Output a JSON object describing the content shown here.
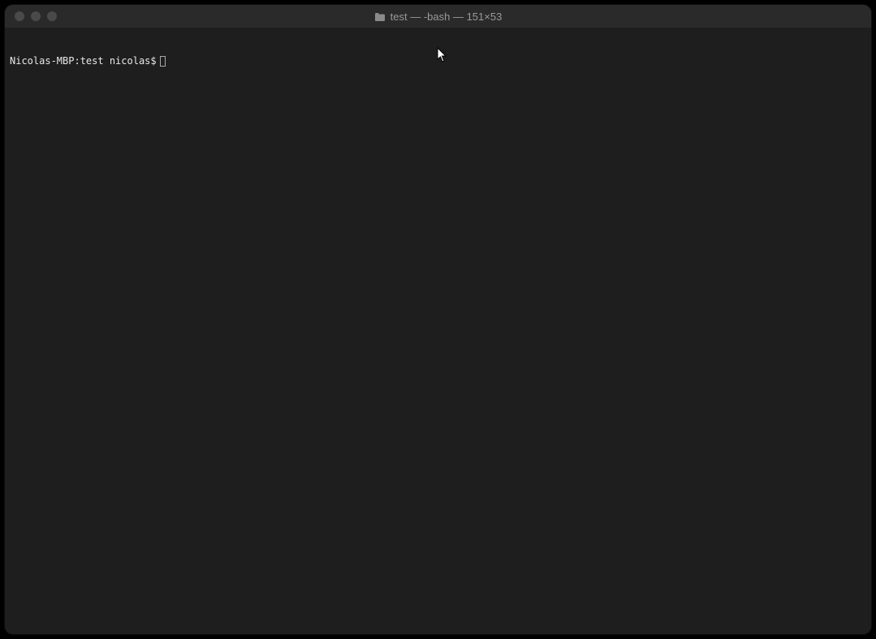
{
  "window": {
    "title": "test — -bash — 151×53"
  },
  "terminal": {
    "prompt": "Nicolas-MBP:test nicolas$"
  }
}
